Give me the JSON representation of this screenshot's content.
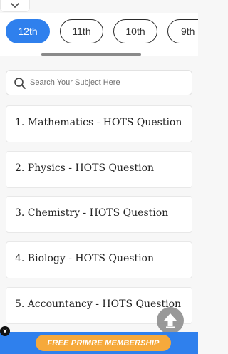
{
  "class_tabs": [
    {
      "label": "12th",
      "active": true
    },
    {
      "label": "11th",
      "active": false
    },
    {
      "label": "10th",
      "active": false
    },
    {
      "label": "9th",
      "active": false
    }
  ],
  "search": {
    "placeholder": "Search Your Subject Here"
  },
  "subjects": [
    {
      "label": "1. Mathematics - HOTS Question"
    },
    {
      "label": "2. Physics - HOTS Question"
    },
    {
      "label": "3. Chemistry - HOTS Question"
    },
    {
      "label": "4. Biology - HOTS Question"
    },
    {
      "label": "5. Accountancy - HOTS Question"
    }
  ],
  "banner": {
    "membership_label": "FREE PRIMRE MEMBERSHIP",
    "close_label": "x"
  },
  "icons": {
    "collapse": "chevron-down-icon",
    "search": "search-icon",
    "scroll_top": "arrow-up-icon"
  },
  "colors": {
    "accent": "#2f80ed",
    "membership": "#f6a93b",
    "scroll_top": "#8f8f8f"
  }
}
